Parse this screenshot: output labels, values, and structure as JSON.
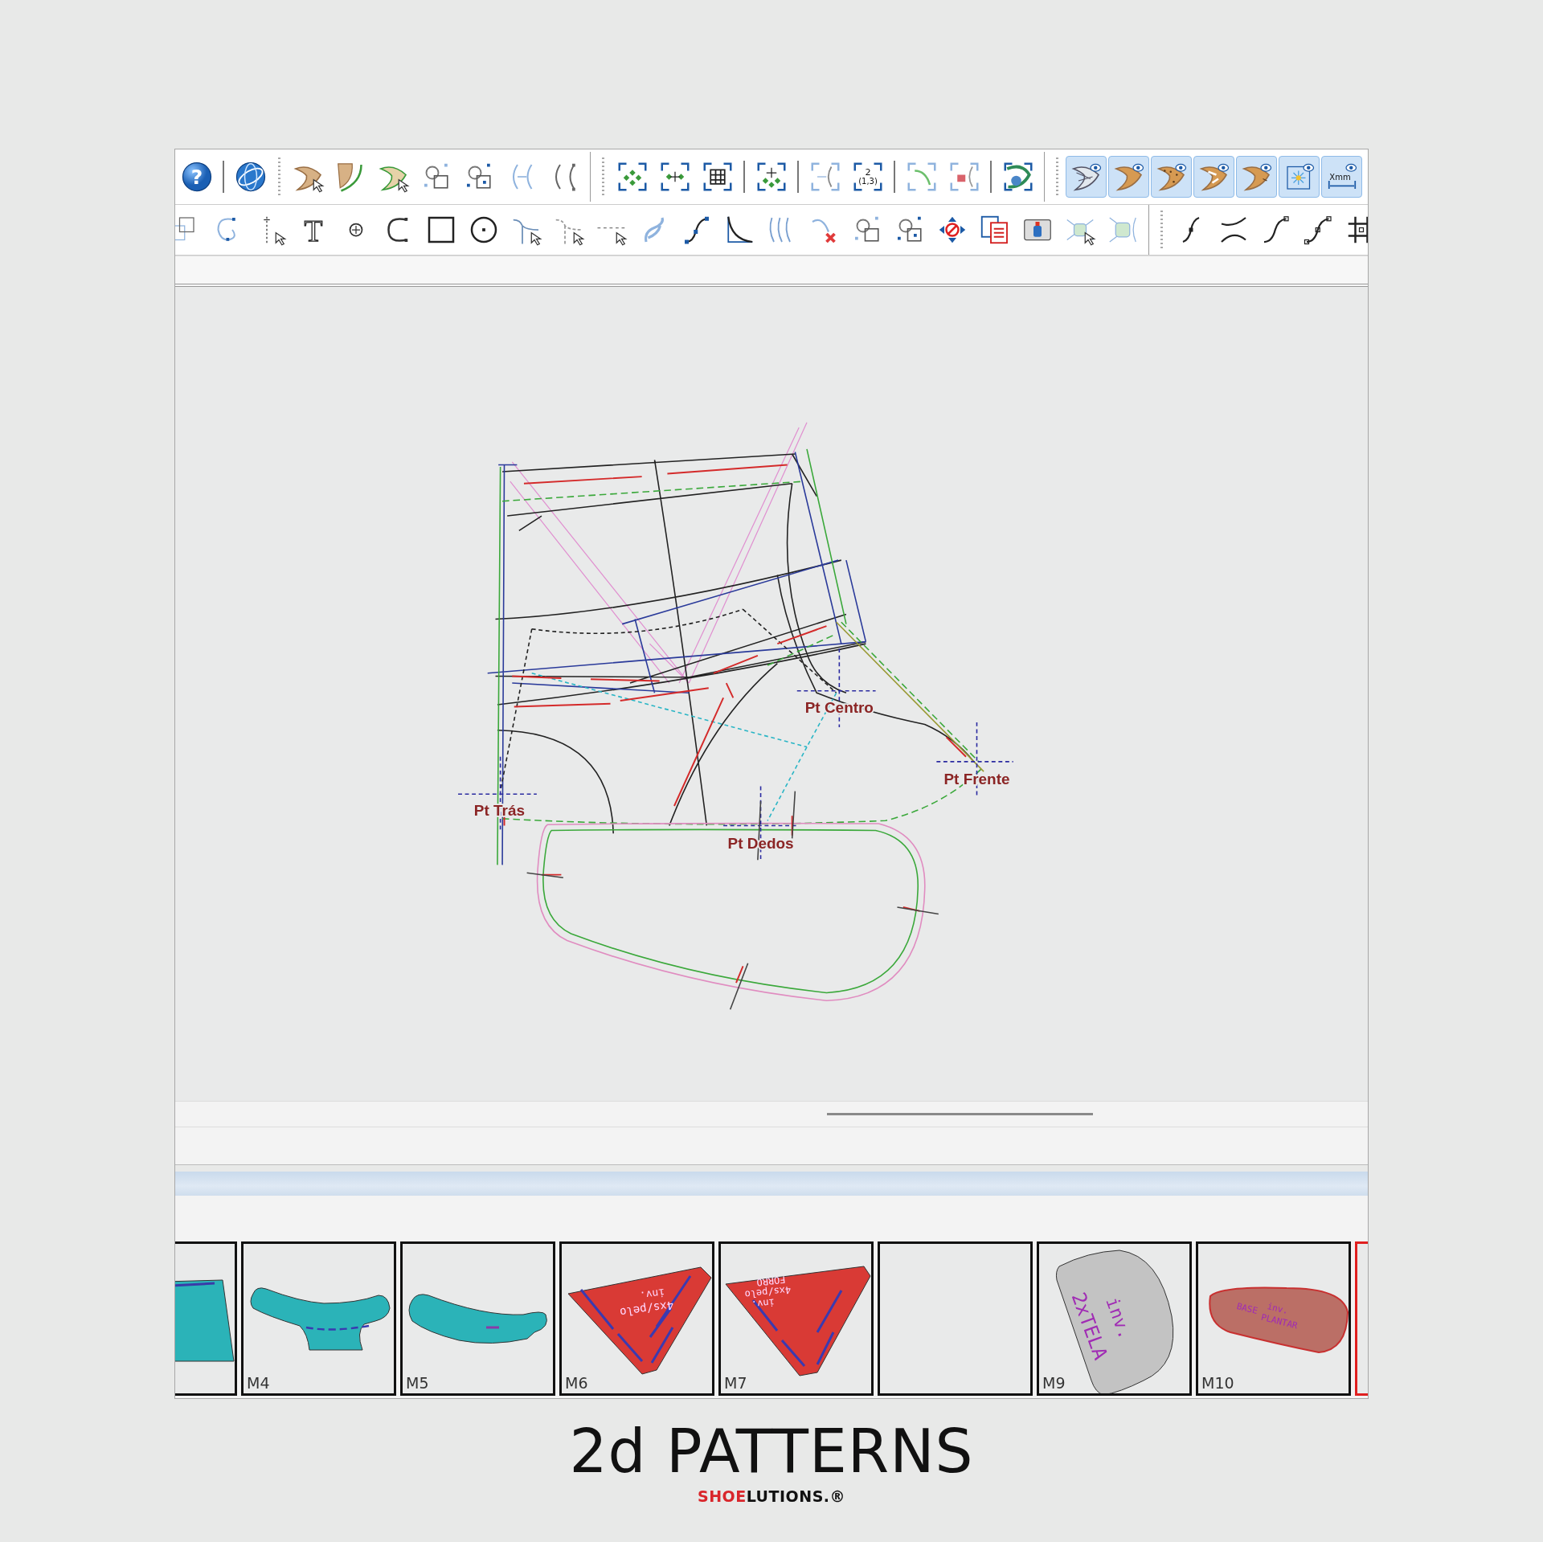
{
  "toolbars": [
    {
      "items": [
        {
          "kind": "help",
          "glyph": "?",
          "pressed": false
        },
        {
          "kind": "divider"
        },
        {
          "kind": "globe",
          "pressed": false
        },
        {
          "kind": "grip"
        },
        {
          "kind": "piece-cursor",
          "pressed": false
        },
        {
          "kind": "piece-curve",
          "pressed": false
        },
        {
          "kind": "piece-outline-cursor",
          "pressed": false
        },
        {
          "kind": "shape-link",
          "pressed": false
        },
        {
          "kind": "shape-link-dots",
          "pressed": false
        },
        {
          "kind": "curve-mirror",
          "pressed": false
        },
        {
          "kind": "curve-mirror-dots",
          "pressed": false
        },
        {
          "kind": "group-end"
        },
        {
          "kind": "grip"
        },
        {
          "kind": "frame-points",
          "pressed": false
        },
        {
          "kind": "frame-points-center",
          "pressed": false
        },
        {
          "kind": "frame-grid",
          "pressed": false
        },
        {
          "kind": "divider"
        },
        {
          "kind": "frame-star",
          "pressed": false
        },
        {
          "kind": "divider"
        },
        {
          "kind": "frame-curve-move",
          "pressed": false
        },
        {
          "kind": "frame-number",
          "glyph": "2",
          "sub": "(1,3)",
          "pressed": false
        },
        {
          "kind": "divider"
        },
        {
          "kind": "frame-arc",
          "pressed": false
        },
        {
          "kind": "frame-lock",
          "pressed": false
        },
        {
          "kind": "divider"
        },
        {
          "kind": "frame-piece",
          "pressed": false
        },
        {
          "kind": "group-end"
        },
        {
          "kind": "grip"
        },
        {
          "kind": "eye-mesh",
          "pressed": true
        },
        {
          "kind": "eye-piece",
          "pressed": true
        },
        {
          "kind": "eye-dots",
          "pressed": true
        },
        {
          "kind": "eye-shine",
          "pressed": true
        },
        {
          "kind": "eye-notch",
          "pressed": true
        },
        {
          "kind": "eye-frame",
          "pressed": true
        },
        {
          "kind": "eye-measure",
          "glyph": "Xmm",
          "pressed": true
        },
        {
          "kind": "group-end"
        }
      ]
    },
    {
      "items": [
        {
          "kind": "overlap-squares",
          "pressed": false
        },
        {
          "kind": "circle-curve",
          "pressed": false
        },
        {
          "kind": "point-cursor",
          "pressed": false
        },
        {
          "kind": "text-tool",
          "glyph": "T",
          "pressed": false
        },
        {
          "kind": "add-point",
          "pressed": false
        },
        {
          "kind": "arc",
          "pressed": false
        },
        {
          "kind": "rectangle",
          "pressed": false
        },
        {
          "kind": "circle",
          "pressed": false
        },
        {
          "kind": "curve-cursor",
          "pressed": false
        },
        {
          "kind": "curve-cursor-dashed",
          "pressed": false
        },
        {
          "kind": "line-cursor",
          "pressed": false
        },
        {
          "kind": "twist",
          "pressed": false
        },
        {
          "kind": "s-curve",
          "pressed": false
        },
        {
          "kind": "corner-curve",
          "pressed": false
        },
        {
          "kind": "waves",
          "pressed": false
        },
        {
          "kind": "curve-delete",
          "pressed": false
        },
        {
          "kind": "shape-link",
          "pressed": false
        },
        {
          "kind": "shape-link-dots",
          "pressed": false
        },
        {
          "kind": "move-block",
          "pressed": false
        },
        {
          "kind": "documents",
          "pressed": false
        },
        {
          "kind": "bottle",
          "pressed": false
        },
        {
          "kind": "mesh-cursor",
          "pressed": false
        },
        {
          "kind": "mesh",
          "pressed": false
        },
        {
          "kind": "group-end"
        },
        {
          "kind": "grip"
        },
        {
          "kind": "curve-one",
          "pressed": false
        },
        {
          "kind": "curve-cross",
          "pressed": false
        },
        {
          "kind": "curve-two",
          "pressed": false
        },
        {
          "kind": "curve-three",
          "pressed": false
        },
        {
          "kind": "grid",
          "pressed": false
        }
      ]
    }
  ],
  "canvas": {
    "point_labels": [
      "Pt Centro",
      "Pt Frente",
      "Pt Trás",
      "Pt Dedos"
    ]
  },
  "pieces": [
    {
      "kind": "heel-band",
      "color": "#2bb3b8",
      "selected": false
    },
    {
      "kind": "strap-wide",
      "label": "M4",
      "color": "#2bb3b8",
      "selected": false
    },
    {
      "kind": "strap-narrow",
      "label": "M5",
      "color": "#2bb3b8",
      "selected": false
    },
    {
      "kind": "lining-a",
      "label": "M6",
      "color": "#d93a35",
      "texts": [
        "inv.",
        "4xs/pelo"
      ],
      "selected": false
    },
    {
      "kind": "lining-b",
      "label": "M7",
      "color": "#d93a35",
      "texts": [
        "FORRO",
        "4xs/pelo",
        "inv."
      ],
      "selected": false
    },
    {
      "kind": "empty",
      "selected": false
    },
    {
      "kind": "tongue",
      "label": "M9",
      "color": "#c3c3c3",
      "texts": [
        "inv.",
        "2xTELA"
      ],
      "selected": false
    },
    {
      "kind": "insole",
      "label": "M10",
      "color": "#bb6f66",
      "texts": [
        "BASE",
        "inv.",
        "PLANTAR"
      ],
      "selected": false
    },
    {
      "kind": "empty",
      "selected": true
    }
  ],
  "caption": {
    "title": "2d PATTERNS",
    "brand": [
      {
        "text": "SHOE",
        "color": "#d9262b"
      },
      {
        "text": "LUTIONS.®",
        "color": "#111111"
      }
    ]
  }
}
